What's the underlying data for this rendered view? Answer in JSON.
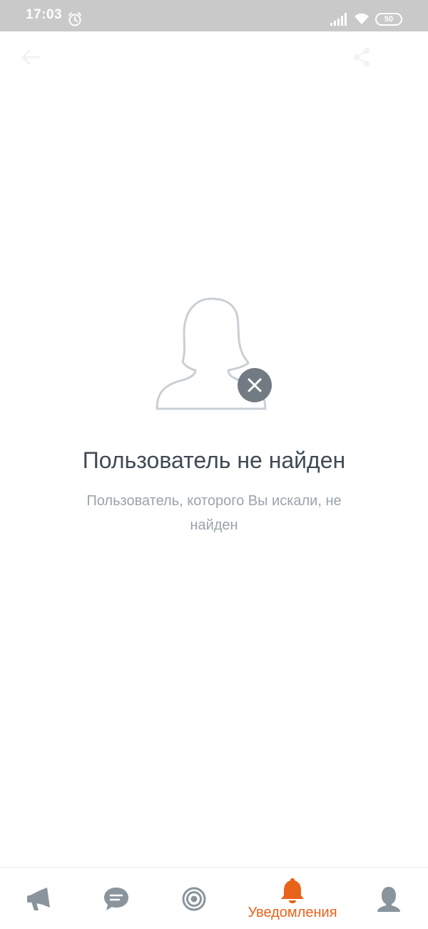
{
  "status_bar": {
    "time": "17:03",
    "battery": "50",
    "icons": [
      "alarm-icon",
      "signal-icon",
      "wifi-icon",
      "battery-icon"
    ]
  },
  "top_bar": {
    "icons": [
      "back-arrow-icon",
      "share-icon"
    ]
  },
  "empty_state": {
    "title": "Пользователь не найден",
    "message": "Пользователь, которого Вы искали, не найден",
    "illustration": "user-not-found-icon"
  },
  "bottom_nav": {
    "items": [
      {
        "icon": "megaphone-icon",
        "label": "",
        "active": false
      },
      {
        "icon": "chat-icon",
        "label": "",
        "active": false
      },
      {
        "icon": "target-icon",
        "label": "",
        "active": false
      },
      {
        "icon": "bell-icon",
        "label": "Уведомления",
        "active": true
      },
      {
        "icon": "profile-icon",
        "label": "",
        "active": false
      }
    ]
  },
  "colors": {
    "accent": "#e8641b",
    "icon_inactive": "#8a949c",
    "title": "#404a55",
    "subtitle": "#9aa3ab",
    "status_bar": "#c9c9c9"
  }
}
